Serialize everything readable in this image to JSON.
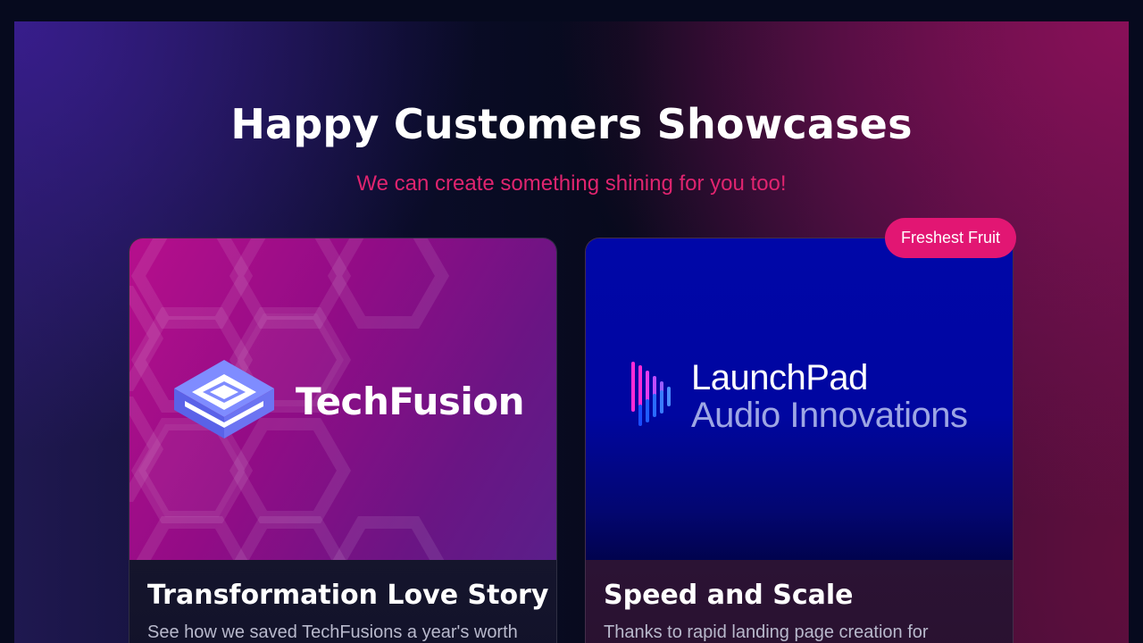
{
  "section": {
    "title": "Happy Customers Showcases",
    "subtitle": "We can create something shining for you too!"
  },
  "colors": {
    "accent_pink": "#e0246f",
    "badge_bg": "#e21673",
    "page_bg": "#060a1e"
  },
  "cards": [
    {
      "logo_name": "TechFusion",
      "logo_icon": "isometric-stack-icon",
      "title": "Transformation Love Story",
      "description": "See how we saved TechFusions a year's worth"
    },
    {
      "badge": "Freshest Fruit",
      "logo_line1": "LaunchPad",
      "logo_line2": "Audio Innovations",
      "logo_icon": "audio-waveform-icon",
      "title": "Speed and Scale",
      "description": "Thanks to rapid landing page creation for"
    }
  ]
}
